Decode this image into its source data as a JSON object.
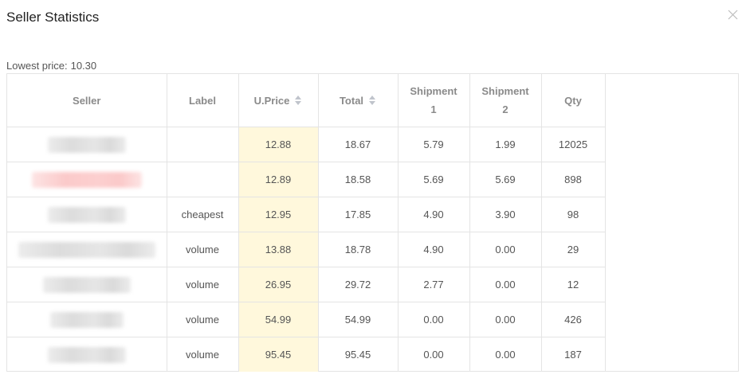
{
  "dialog": {
    "title": "Seller Statistics",
    "lowest_price_label": "Lowest price:",
    "lowest_price_value": "10.30"
  },
  "table": {
    "headers": {
      "seller": "Seller",
      "label": "Label",
      "uprice": "U.Price",
      "total": "Total",
      "shipment1": "Shipment 1",
      "shipment2": "Shipment 2",
      "qty": "Qty"
    },
    "rows": [
      {
        "label": "",
        "uprice": "12.88",
        "total": "18.67",
        "shipment1": "5.79",
        "shipment2": "1.99",
        "qty": "12025"
      },
      {
        "label": "",
        "uprice": "12.89",
        "total": "18.58",
        "shipment1": "5.69",
        "shipment2": "5.69",
        "qty": "898"
      },
      {
        "label": "cheapest",
        "uprice": "12.95",
        "total": "17.85",
        "shipment1": "4.90",
        "shipment2": "3.90",
        "qty": "98"
      },
      {
        "label": "volume",
        "uprice": "13.88",
        "total": "18.78",
        "shipment1": "4.90",
        "shipment2": "0.00",
        "qty": "29"
      },
      {
        "label": "volume",
        "uprice": "26.95",
        "total": "29.72",
        "shipment1": "2.77",
        "shipment2": "0.00",
        "qty": "12"
      },
      {
        "label": "volume",
        "uprice": "54.99",
        "total": "54.99",
        "shipment1": "0.00",
        "shipment2": "0.00",
        "qty": "426"
      },
      {
        "label": "volume",
        "uprice": "95.45",
        "total": "95.45",
        "shipment1": "0.00",
        "shipment2": "0.00",
        "qty": "187"
      }
    ]
  },
  "icons": {
    "close": "close-icon",
    "sort": "sort-icon"
  },
  "colors": {
    "uprice_highlight": "#fff8dc",
    "border": "#e4e4e4",
    "header_text": "#8a8a8a",
    "highlighted_seller": "#fbcaca"
  }
}
